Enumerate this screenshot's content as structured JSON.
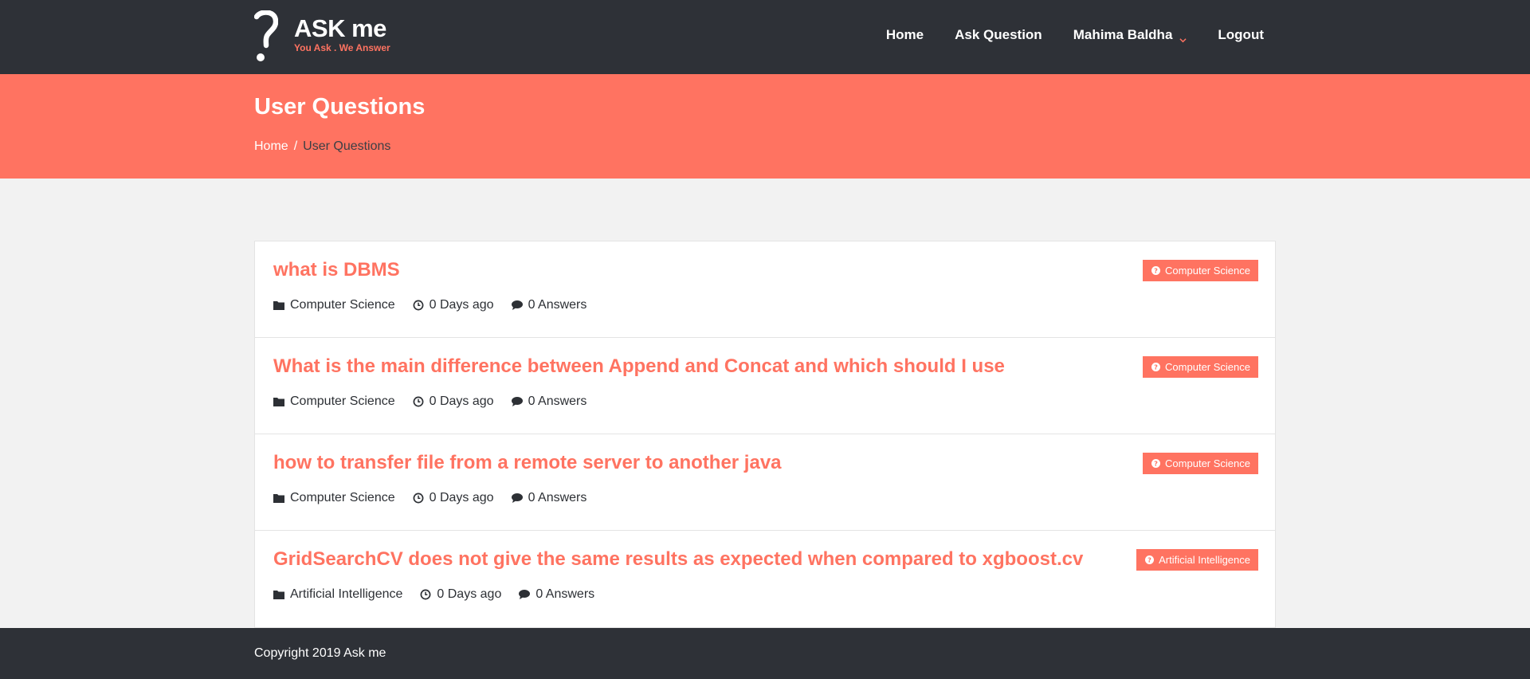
{
  "header": {
    "logo_title": "ASK me",
    "logo_tagline": "You Ask . We Answer",
    "nav": {
      "home": "Home",
      "ask_question": "Ask Question",
      "user": "Mahima Baldha",
      "logout": "Logout"
    }
  },
  "banner": {
    "title": "User Questions",
    "breadcrumb_home": "Home",
    "breadcrumb_separator": "/",
    "breadcrumb_current": "User Questions"
  },
  "questions": [
    {
      "title": "what is DBMS",
      "category": "Computer Science",
      "time": "0 Days ago",
      "answers": "0 Answers",
      "tag": "Computer Science"
    },
    {
      "title": "What is the main difference between Append and Concat and which should I use",
      "category": "Computer Science",
      "time": "0 Days ago",
      "answers": "0 Answers",
      "tag": "Computer Science"
    },
    {
      "title": "how to transfer file from a remote server to another java",
      "category": "Computer Science",
      "time": "0 Days ago",
      "answers": "0 Answers",
      "tag": "Computer Science"
    },
    {
      "title": "GridSearchCV does not give the same results as expected when compared to xgboost.cv",
      "category": "Artificial Intelligence",
      "time": "0 Days ago",
      "answers": "0 Answers",
      "tag": "Artificial Intelligence"
    }
  ],
  "footer": {
    "copyright": "Copyright 2019 Ask me"
  },
  "colors": {
    "accent": "#ff7361",
    "dark": "#2e3137",
    "page_bg": "#f2f2f2"
  },
  "icons": {
    "logo": "question-mark-icon",
    "user_menu": "chevron-down-icon",
    "category": "folder-icon",
    "time": "clock-icon",
    "answers": "comment-icon",
    "tag": "question-circle-icon"
  }
}
